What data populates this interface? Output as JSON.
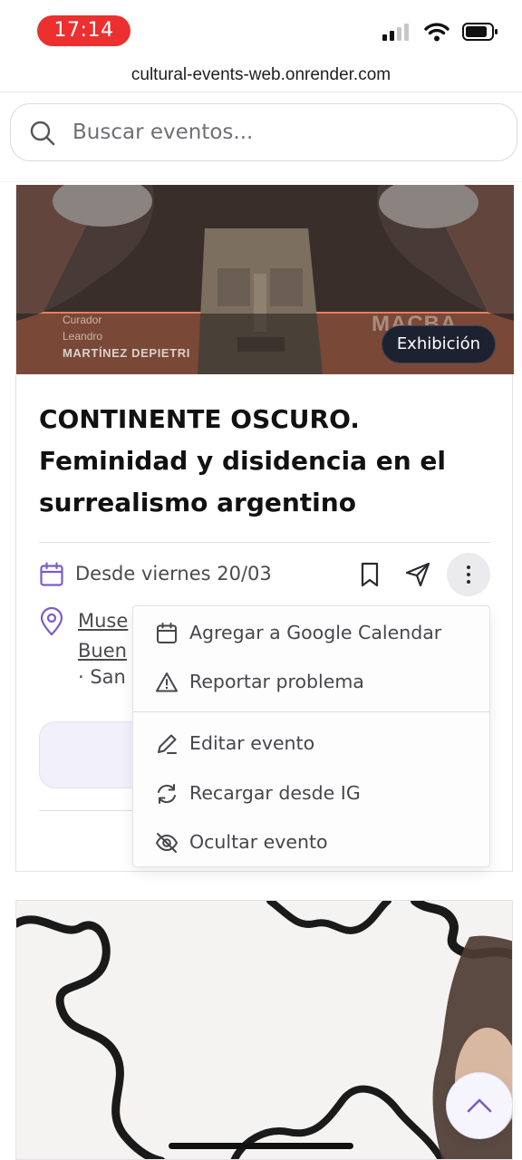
{
  "status_bar": {
    "time": "17:14",
    "icons": [
      "cellular-signal-icon",
      "wifi-icon",
      "battery-icon"
    ]
  },
  "browser": {
    "url": "cultural-events-web.onrender.com"
  },
  "search": {
    "placeholder": "Buscar eventos..."
  },
  "event": {
    "hero_image": {
      "credit_label": "Curador",
      "credit_first_name": "Leandro",
      "credit_name": "MARTÍNEZ DEPIETRI",
      "logo_text": "MACBA"
    },
    "badge": "Exhibición",
    "title": "CONTINENTE OSCURO. Feminidad y disidencia en el surrealismo argentino",
    "date": "Desde viernes 20/03",
    "location": {
      "line1": "Muse",
      "line2": "Buen",
      "line3": "· San"
    }
  },
  "menu": {
    "items": [
      {
        "label": "Agregar a Google Calendar",
        "icon": "calendar-icon"
      },
      {
        "label": "Reportar problema",
        "icon": "warning-icon"
      },
      {
        "label": "Editar evento",
        "icon": "pencil-icon"
      },
      {
        "label": "Recargar desde IG",
        "icon": "refresh-icon"
      },
      {
        "label": "Ocultar evento",
        "icon": "eye-off-icon"
      }
    ]
  },
  "colors": {
    "accent": "#7c5cc4",
    "badge_bg": "#1c2230",
    "hero_orange": "#e9805b",
    "status_red": "#ec2f2f"
  }
}
